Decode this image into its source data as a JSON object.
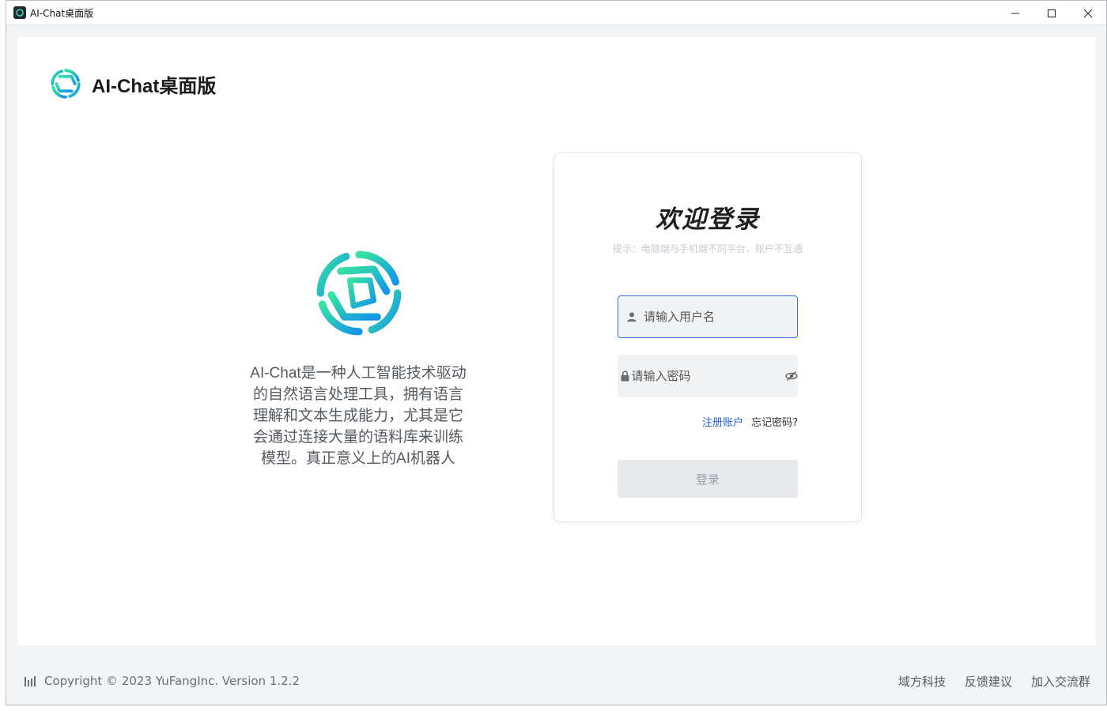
{
  "window": {
    "title": "AI-Chat桌面版",
    "controls": {
      "minimize": "—",
      "maximize": "☐",
      "close": "✕"
    }
  },
  "brand": {
    "name": "AI-Chat桌面版"
  },
  "description": "AI-Chat是一种人工智能技术驱动的自然语言处理工具，拥有语言理解和文本生成能力，尤其是它会通过连接大量的语料库来训练模型。真正意义上的AI机器人",
  "login": {
    "title": "欢迎登录",
    "hint": "提示：电脑端与手机端不同平台，账户不互通",
    "username_placeholder": "请输入用户名",
    "password_placeholder": "请输入密码",
    "register_link": "注册账户",
    "forgot_link": "忘记密码?",
    "submit_label": "登录"
  },
  "footer": {
    "copyright": "Copyright © 2023 YuFangInc. Version 1.2.2",
    "links": [
      "域方科技",
      "反馈建议",
      "加入交流群"
    ]
  },
  "colors": {
    "accent": "#2b5fd9",
    "logo_start": "#2fe0a0",
    "logo_end": "#1a9fe8"
  }
}
